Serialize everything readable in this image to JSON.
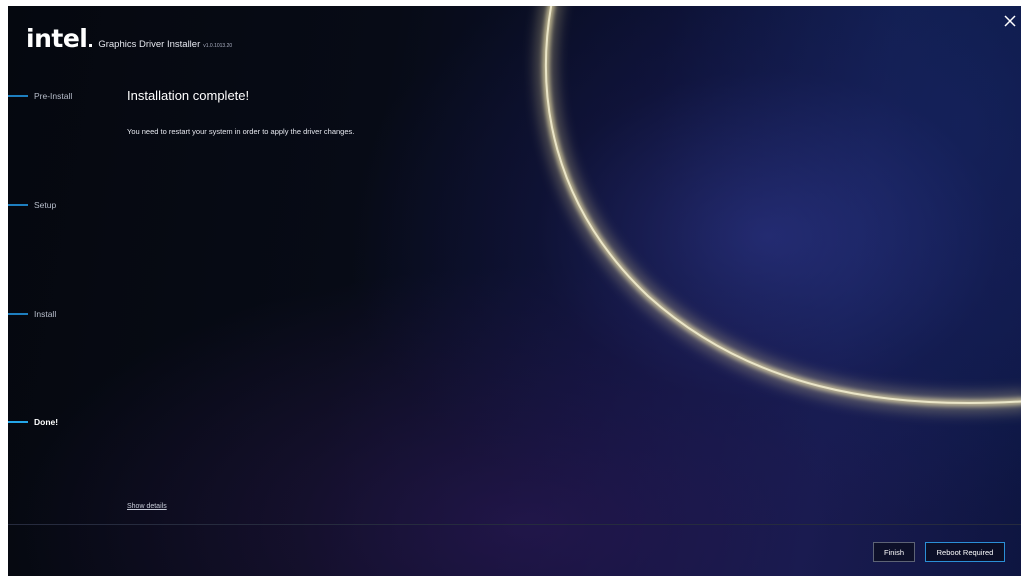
{
  "header": {
    "logo_text": "intel",
    "app_title": "Graphics Driver Installer",
    "version": "v1.0.1013.20"
  },
  "steps": [
    {
      "label": "Pre-Install",
      "active": false
    },
    {
      "label": "Setup",
      "active": false
    },
    {
      "label": "Install",
      "active": false
    },
    {
      "label": "Done!",
      "active": true
    }
  ],
  "main": {
    "heading": "Installation complete!",
    "message": "You need to restart your system in order to apply the driver changes.",
    "show_details_label": "Show details"
  },
  "footer": {
    "finish_label": "Finish",
    "reboot_label": "Reboot Required"
  },
  "colors": {
    "accent": "#24a6e8",
    "step_bar": "#1e7fc0",
    "background": "#070b16"
  },
  "icons": {
    "close": "close-icon"
  }
}
